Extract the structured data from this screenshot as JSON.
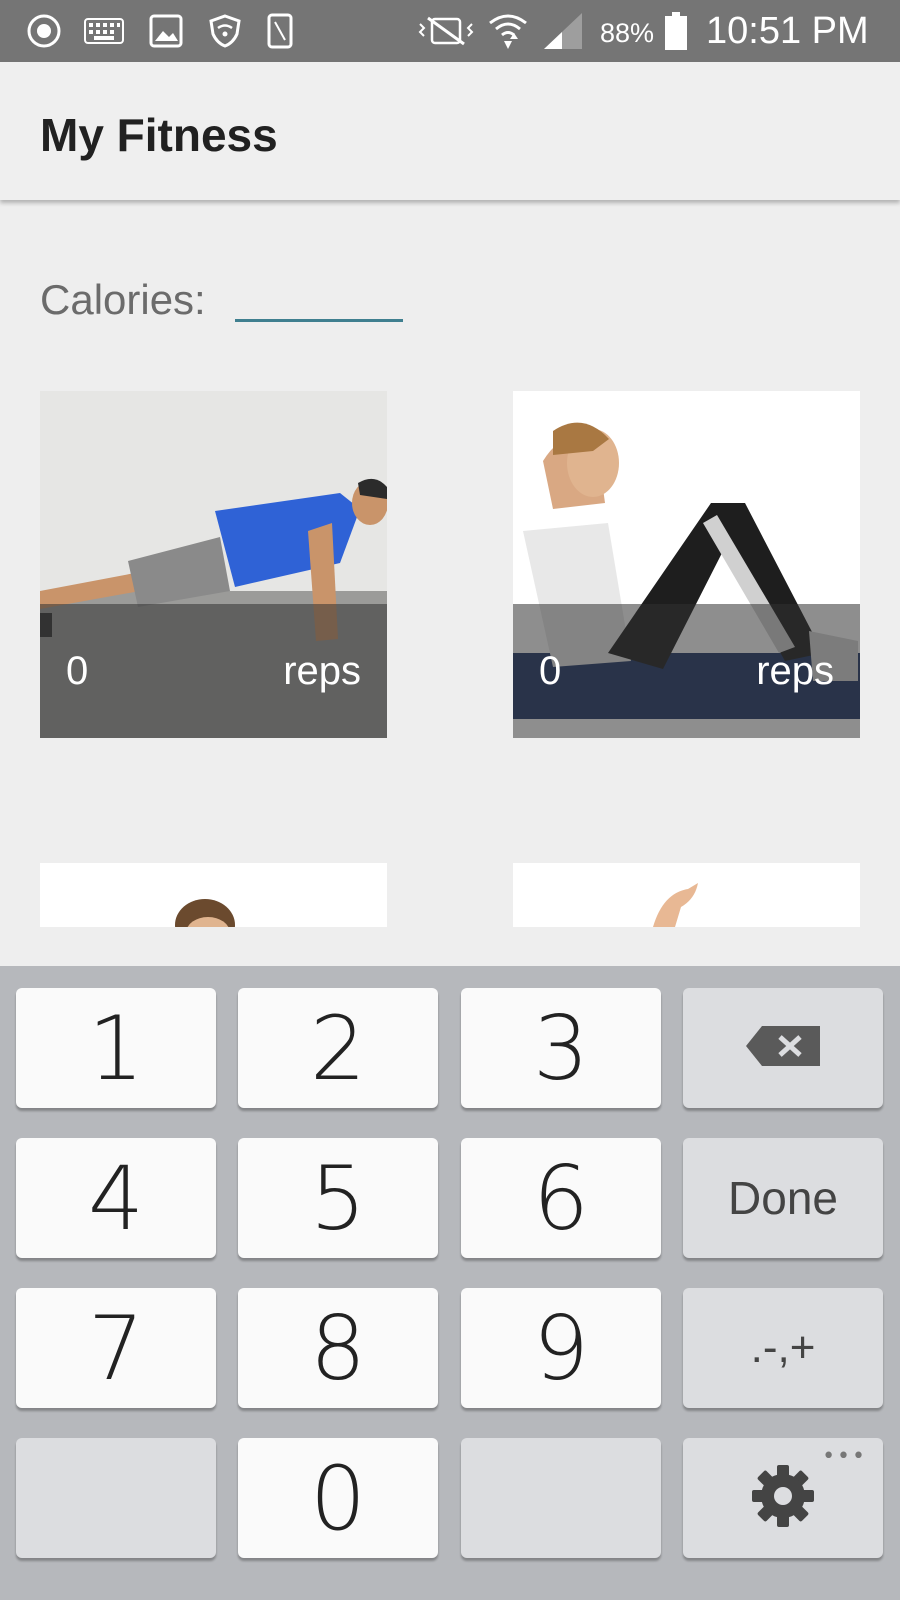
{
  "status_bar": {
    "battery_percent": "88%",
    "time": "10:51 PM",
    "icons": [
      "media-play-icon",
      "keyboard-icon",
      "image-icon",
      "shield-wifi-icon",
      "phone-icon",
      "vibrate-icon",
      "wifi-icon",
      "signal-icon",
      "battery-icon"
    ]
  },
  "app_bar": {
    "title": "My Fitness"
  },
  "calories": {
    "label": "Calories:",
    "value": ""
  },
  "exercises": [
    {
      "name": "pushup",
      "count": "0",
      "unit": "reps"
    },
    {
      "name": "situp",
      "count": "0",
      "unit": "reps"
    },
    {
      "name": "partial-3"
    },
    {
      "name": "partial-4"
    }
  ],
  "keyboard": {
    "keys": [
      "1",
      "2",
      "3",
      "4",
      "5",
      "6",
      "7",
      "8",
      "9",
      "0"
    ],
    "done_label": "Done",
    "symbols_label": ".-,+",
    "more_dots": "•••"
  },
  "colors": {
    "status_bar": "#757575",
    "background": "#eeeeee",
    "accent_underline": "#3f7f8f",
    "keyboard_bg": "#b6b8bc"
  }
}
